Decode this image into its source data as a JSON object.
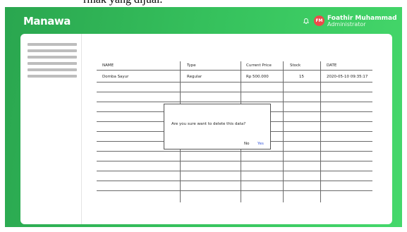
{
  "top_text": "rmak yang dijual.",
  "app": {
    "logo": "Manawa"
  },
  "header": {
    "avatar_initials": "FM",
    "user_name": "Foathir Muhammad",
    "user_role": "Administrator",
    "notification_icon": "bell-icon"
  },
  "table": {
    "columns": [
      "NAME",
      "Type",
      "Current Price",
      "Stock",
      "DATE"
    ],
    "rows": [
      {
        "name": "Domba Sayur",
        "type": "Regular",
        "price": "Rp 500.000",
        "stock": "15",
        "date": "2020-05-10 09:35:17"
      }
    ]
  },
  "dialog": {
    "message": "Are you sure want to delete this data?",
    "no_label": "No",
    "yes_label": "Yes"
  },
  "colors": {
    "brand_green_start": "#2aa64f",
    "brand_green_end": "#45d86b",
    "avatar": "#ec4a4a",
    "yes_button": "#3b5bdb"
  }
}
